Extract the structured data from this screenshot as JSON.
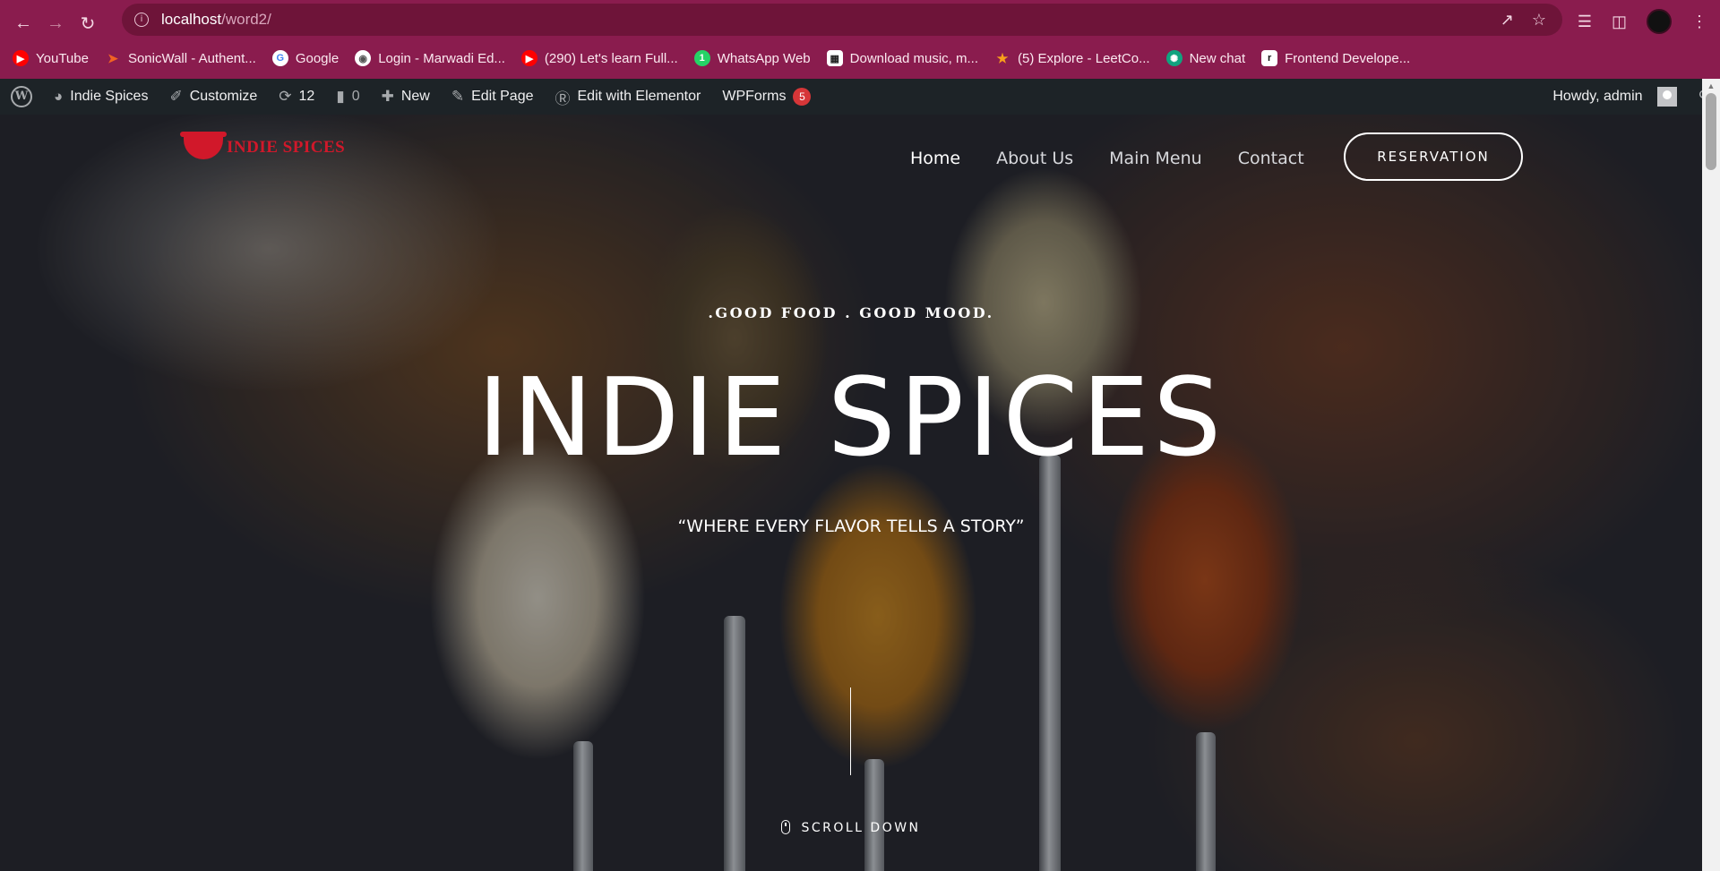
{
  "browser": {
    "url_host": "localhost",
    "url_path": "/word2/",
    "bookmarks": [
      {
        "label": "YouTube",
        "icon": "youtube-icon",
        "color": "#ff0000"
      },
      {
        "label": "SonicWall - Authent...",
        "icon": "sonicwall-icon",
        "color": "#f26322"
      },
      {
        "label": "Google",
        "icon": "google-icon",
        "color": "#4285f4"
      },
      {
        "label": "Login - Marwadi Ed...",
        "icon": "globe-icon",
        "color": "#555555"
      },
      {
        "label": "(290) Let's learn Full...",
        "icon": "youtube-icon",
        "color": "#ff0000"
      },
      {
        "label": "WhatsApp Web",
        "icon": "whatsapp-icon",
        "color": "#25d366"
      },
      {
        "label": "Download music, m...",
        "icon": "download-site-icon",
        "color": "#222222"
      },
      {
        "label": "(5) Explore - LeetCo...",
        "icon": "leetcode-icon",
        "color": "#f89f1b"
      },
      {
        "label": "New chat",
        "icon": "chatgpt-icon",
        "color": "#10a37f"
      },
      {
        "label": "Frontend Develope...",
        "icon": "frontend-site-icon",
        "color": "#111111"
      }
    ]
  },
  "adminbar": {
    "site_name": "Indie Spices",
    "customize": "Customize",
    "updates_count": "12",
    "comments_count": "0",
    "new_label": "New",
    "edit_page": "Edit Page",
    "elementor": "Edit with Elementor",
    "wpforms": "WPForms",
    "wpforms_badge": "5",
    "howdy": "Howdy, admin"
  },
  "site": {
    "logo_text": "INDIE SPICES",
    "brand_color": "#d1182a",
    "nav": [
      "Home",
      "About Us",
      "Main Menu",
      "Contact"
    ],
    "active_nav": "Home",
    "reservation": "RESERVATION"
  },
  "hero": {
    "tagline": ".GOOD FOOD . GOOD MOOD.",
    "title": "INDIE SPICES",
    "subtitle": "“WHERE EVERY FLAVOR TELLS A STORY”",
    "scroll": "SCROLL DOWN"
  },
  "colors": {
    "browser_frame": "#8a1c4e",
    "adminbar_bg": "#1d2327",
    "badge": "#d63638"
  }
}
